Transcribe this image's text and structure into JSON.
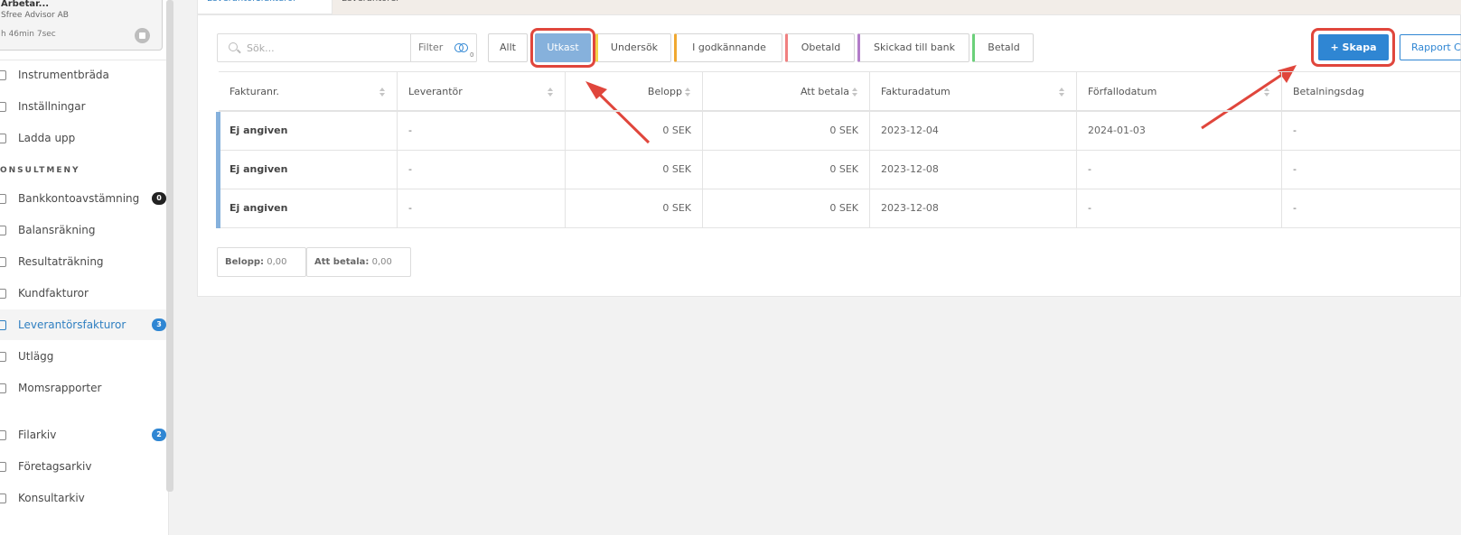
{
  "session": {
    "title": "Arbetar...",
    "org": "Sfree Advisor AB",
    "time": "h 46min 7sec"
  },
  "sidebar": {
    "top_items": [
      {
        "label": "Instrumentbräda"
      },
      {
        "label": "Inställningar"
      },
      {
        "label": "Ladda upp"
      }
    ],
    "section_title": "ONSULTMENY",
    "consult_items": [
      {
        "label": "Bankkontoavstämning",
        "badge": "0"
      },
      {
        "label": "Balansräkning"
      },
      {
        "label": "Resultaträkning"
      },
      {
        "label": "Kundfakturor"
      },
      {
        "label": "Leverantörsfakturor",
        "badge": "3"
      },
      {
        "label": "Utlägg"
      },
      {
        "label": "Momsrapporter"
      }
    ],
    "archive_items": [
      {
        "label": "Filarkiv",
        "badge": "2"
      },
      {
        "label": "Företagsarkiv"
      },
      {
        "label": "Konsultarkiv"
      }
    ]
  },
  "tabs": [
    {
      "label": "Leverantörsfakturor"
    },
    {
      "label": "Leverantörer"
    }
  ],
  "search": {
    "placeholder": "Sök...",
    "filter_label": "Filter",
    "filter_count": "0"
  },
  "status_filters": [
    {
      "label": "Allt",
      "color": "#d5d5d5"
    },
    {
      "label": "Utkast",
      "color": "#86b1dc"
    },
    {
      "label": "Undersök",
      "color": "#f3d34a"
    },
    {
      "label": "I godkännande",
      "color": "#f0a830"
    },
    {
      "label": "Obetald",
      "color": "#f08080"
    },
    {
      "label": "Skickad till bank",
      "color": "#b27cc9"
    },
    {
      "label": "Betald",
      "color": "#6bd07a"
    }
  ],
  "actions": {
    "create_label": "+ Skapa",
    "report_label": "Rapport C"
  },
  "table": {
    "columns": [
      "Fakturanr.",
      "Leverantör",
      "Belopp",
      "Att betala",
      "Fakturadatum",
      "Förfallodatum",
      "Betalningsdag"
    ],
    "rows": [
      [
        "Ej angiven",
        "-",
        "0 SEK",
        "0 SEK",
        "2023-12-04",
        "2024-01-03",
        "-"
      ],
      [
        "Ej angiven",
        "-",
        "0 SEK",
        "0 SEK",
        "2023-12-08",
        "-",
        "-"
      ],
      [
        "Ej angiven",
        "-",
        "0 SEK",
        "0 SEK",
        "2023-12-08",
        "-",
        "-"
      ]
    ]
  },
  "summary": {
    "belopp_label": "Belopp:",
    "belopp_value": "0,00",
    "att_betala_label": "Att betala:",
    "att_betala_value": "0,00"
  },
  "colors": {
    "accent": "#2f86d3",
    "highlight": "#e0463c",
    "draft": "#86b1dc"
  }
}
